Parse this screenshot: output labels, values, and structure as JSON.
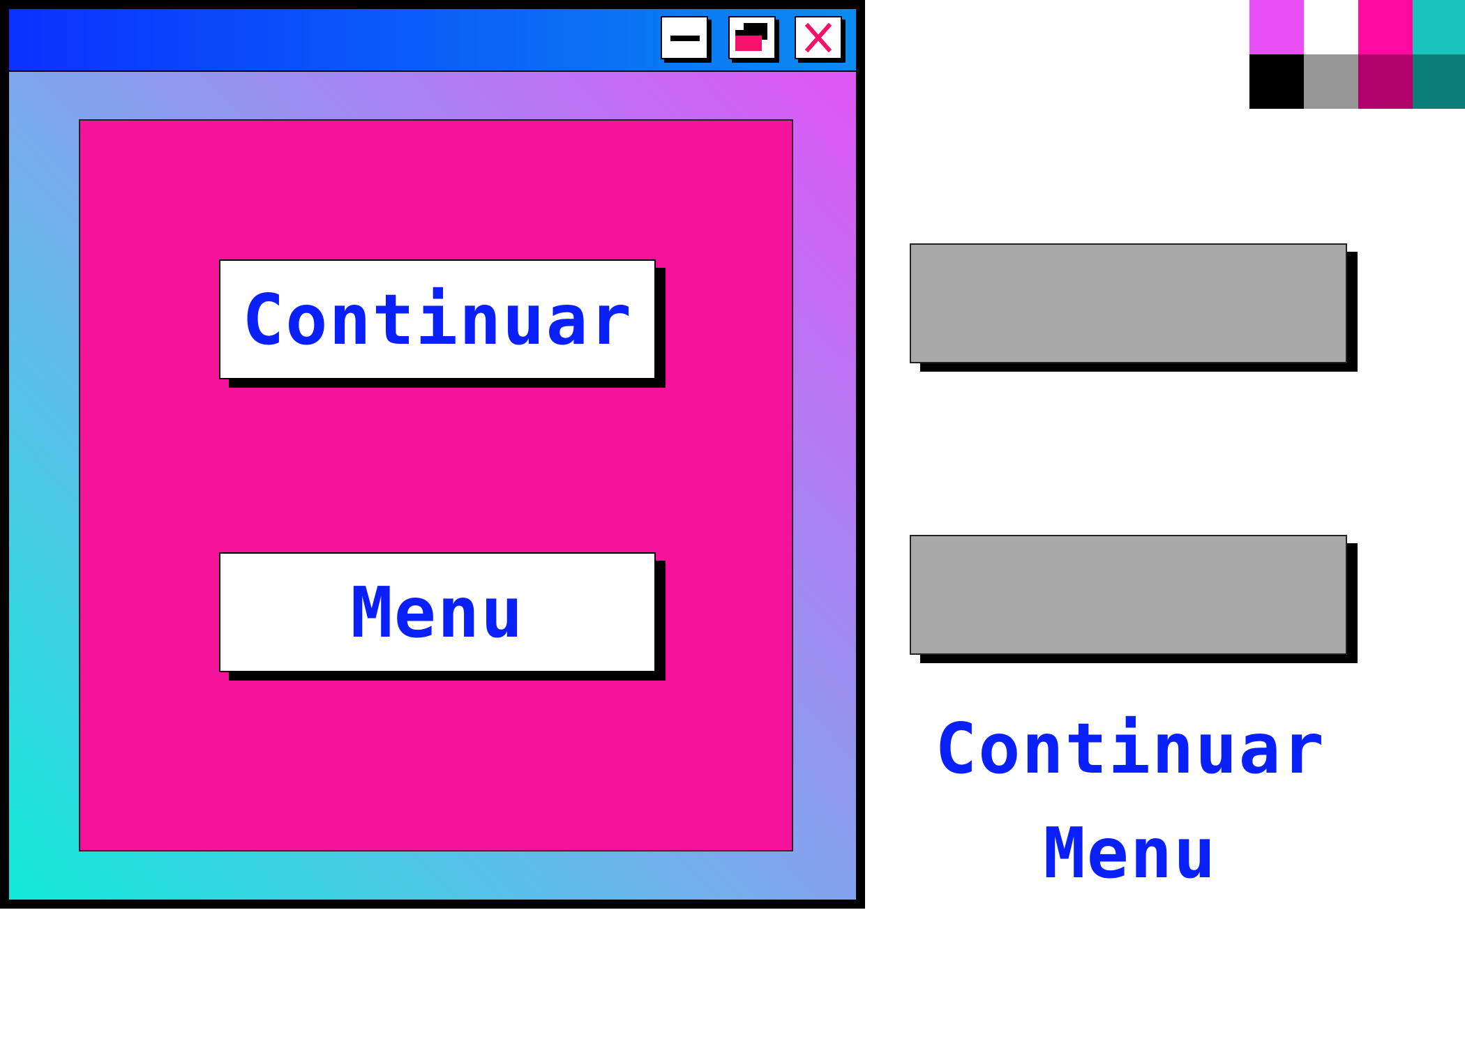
{
  "window": {
    "titlebar_buttons": [
      {
        "icon": "minimize-icon"
      },
      {
        "icon": "maximize-icon"
      },
      {
        "icon": "close-icon"
      }
    ],
    "buttons": {
      "continue_label": "Continuar",
      "menu_label": "Menu"
    }
  },
  "palette": {
    "swatches": [
      "#e84ff7",
      "#ffffff",
      "#ff0aa0",
      "#19c2bd",
      "#000000",
      "#969696",
      "#b0006c",
      "#0b7f78"
    ]
  },
  "assets": {
    "labels": {
      "continue": "Continuar",
      "menu": "Menu"
    }
  },
  "colors": {
    "accent_blue": "#0a20f8",
    "panel_pink": "#f5139c",
    "titlebar_start": "#0a31ff",
    "titlebar_end": "#0a8cf0"
  }
}
